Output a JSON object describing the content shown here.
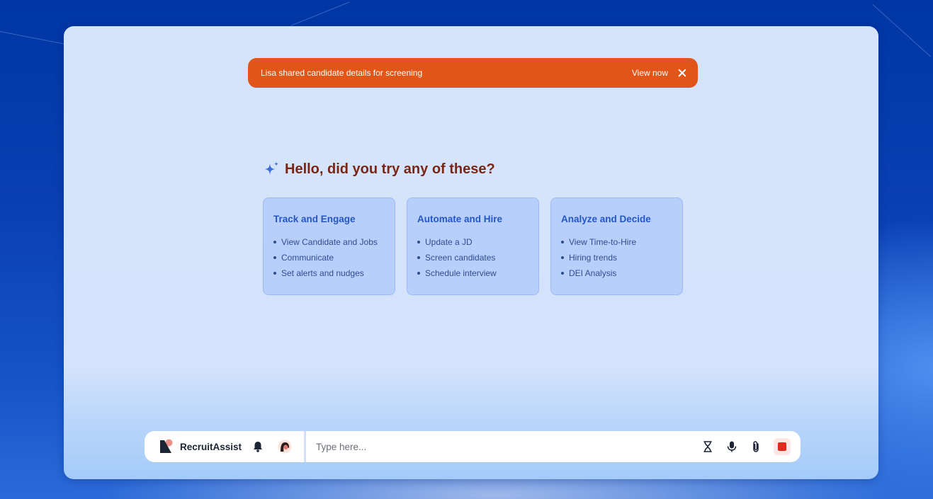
{
  "notification": {
    "message": "Lisa shared candidate details for screening",
    "action_label": "View now",
    "color": "#e15518"
  },
  "greeting": {
    "icon": "sparkle-icon",
    "text": "Hello, did you try any of these?"
  },
  "cards": [
    {
      "title": "Track and Engage",
      "items": [
        "View Candidate and Jobs",
        "Communicate",
        "Set alerts and nudges"
      ]
    },
    {
      "title": "Automate and Hire",
      "items": [
        "Update a JD",
        "Screen candidates",
        "Schedule interview"
      ]
    },
    {
      "title": "Analyze and Decide",
      "items": [
        "View Time-to-Hire",
        "Hiring trends",
        "DEI Analysis"
      ]
    }
  ],
  "bottom_bar": {
    "brand": "RecruitAssist",
    "brand_icon": "recruitassist-logo-icon",
    "input_placeholder": "Type here...",
    "icons": [
      "bell-icon",
      "avatar",
      "hourglass-icon",
      "microphone-icon",
      "paperclip-icon",
      "stop-icon"
    ],
    "stop_color": "#e02c1e"
  }
}
